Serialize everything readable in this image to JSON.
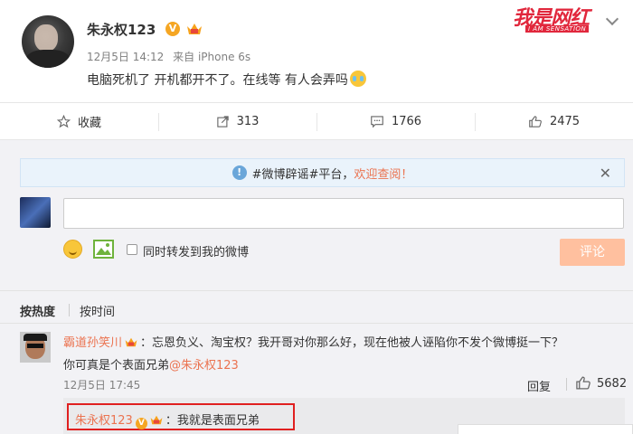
{
  "post": {
    "username": "朱永权123",
    "verified_badge": "V",
    "time": "12月5日 14:12",
    "source": "来自 iPhone 6s",
    "text": "电脑死机了 开机都开不了。在线等 有人会弄吗"
  },
  "watermark": {
    "main": "我是网红",
    "sub": "I AM SENSATION"
  },
  "actions": {
    "favorite_label": "收藏",
    "repost_count": "313",
    "comment_count": "1766",
    "like_count": "2475"
  },
  "rumor_banner": {
    "tag": "#微博辟谣#平台，",
    "link": "欢迎查阅！"
  },
  "composer": {
    "input_value": "",
    "repost_label": "同时转发到我的微博",
    "submit_label": "评论"
  },
  "sort": {
    "hot": "按热度",
    "time": "按时间"
  },
  "comment": {
    "author": "霸道孙笑川",
    "text_line1": "：忘恩负义、淘宝权？我开哥对你那么好，现在他被人诬陷你不发个微博挺一下？",
    "text_line2": "你可真是个表面兄弟",
    "mention": "@朱永权123",
    "time": "12月5日 17:45",
    "reply_label": "回复",
    "likes": "5682"
  },
  "reply": {
    "author": "朱永权123",
    "badge": "V",
    "text": "：我就是表面兄弟"
  },
  "colors": {
    "accent": "#eb7350",
    "verified": "#f5a623",
    "submit_disabled": "#ffc09f",
    "highlight_border": "#e02020",
    "watermark": "#e1273c"
  }
}
